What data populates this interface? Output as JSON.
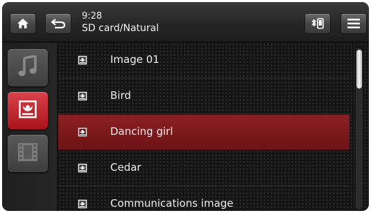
{
  "status": {
    "time": "9:28",
    "path": "SD card/Natural"
  },
  "toolbar": {
    "icons": [
      "home-icon",
      "back-icon",
      "bluetooth-phone-icon",
      "menu-icon"
    ]
  },
  "sidebar": {
    "items": [
      {
        "name": "music",
        "icon": "music-note-icon",
        "active": false
      },
      {
        "name": "pictures",
        "icon": "picture-icon",
        "active": true
      },
      {
        "name": "videos",
        "icon": "film-icon",
        "active": false
      }
    ]
  },
  "list": {
    "items": [
      {
        "label": "Image 01",
        "selected": false
      },
      {
        "label": "Bird",
        "selected": false
      },
      {
        "label": "Dancing girl",
        "selected": true
      },
      {
        "label": "Cedar",
        "selected": false
      },
      {
        "label": "Communications image",
        "selected": false
      }
    ],
    "scroll_position": 0
  },
  "colors": {
    "accent": "#b51f26",
    "selected_row": "#7d1a1d",
    "background": "#161616",
    "text": "#efefef"
  }
}
